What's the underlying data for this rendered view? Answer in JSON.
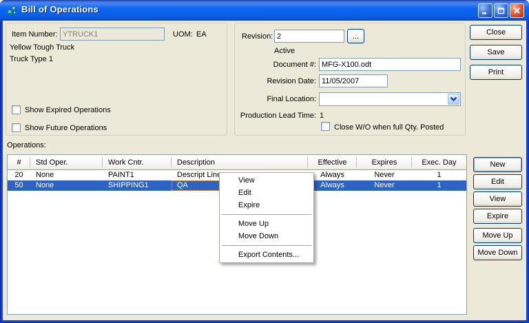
{
  "window": {
    "title": "Bill of Operations"
  },
  "item": {
    "item_number_label": "Item Number:",
    "item_number_value": "YTRUCK1",
    "uom_label": "UOM:",
    "uom_value": "EA",
    "description_line1": "Yellow Tough Truck",
    "description_line2": "Truck Type 1",
    "show_expired_label": "Show Expired Operations",
    "show_future_label": "Show Future Operations"
  },
  "revision": {
    "label": "Revision:",
    "value": "2",
    "browse_label": "...",
    "status": "Active",
    "document_label": "Document #:",
    "document_value": "MFG-X100.odt",
    "revision_date_label": "Revision Date:",
    "revision_date_value": "11/05/2007",
    "final_location_label": "Final Location:",
    "final_location_value": "",
    "production_lead_time_label": "Production Lead Time:",
    "production_lead_time_value": "1",
    "close_wo_label": "Close W/O when full Qty. Posted"
  },
  "actions": {
    "close": "Close",
    "save": "Save",
    "print": "Print"
  },
  "operations": {
    "label": "Operations:",
    "columns": [
      "#",
      "Std Oper.",
      "Work Cntr.",
      "Description",
      "Effective",
      "Expires",
      "Exec. Day"
    ],
    "rows": [
      {
        "num": "20",
        "std_oper": "None",
        "work_cntr": "PAINT1",
        "description": "Descript Line",
        "effective": "Always",
        "expires": "Never",
        "exec_day": "1"
      },
      {
        "num": "50",
        "std_oper": "None",
        "work_cntr": "SHIPPING1",
        "description": "QA",
        "effective": "Always",
        "expires": "Never",
        "exec_day": "1"
      }
    ],
    "buttons": [
      "New",
      "Edit",
      "View",
      "Expire",
      "Move Up",
      "Move Down"
    ]
  },
  "context_menu": {
    "items": [
      "View",
      "Edit",
      "Expire",
      "Move Up",
      "Move Down",
      "Export Contents..."
    ]
  },
  "colors": {
    "titlebar_blue": "#0A62EC",
    "window_border": "#0D43D8",
    "dialog_background": "#ECE9D8",
    "selection_blue": "#2E63C4",
    "textbox_border": "#7F9DB9"
  }
}
